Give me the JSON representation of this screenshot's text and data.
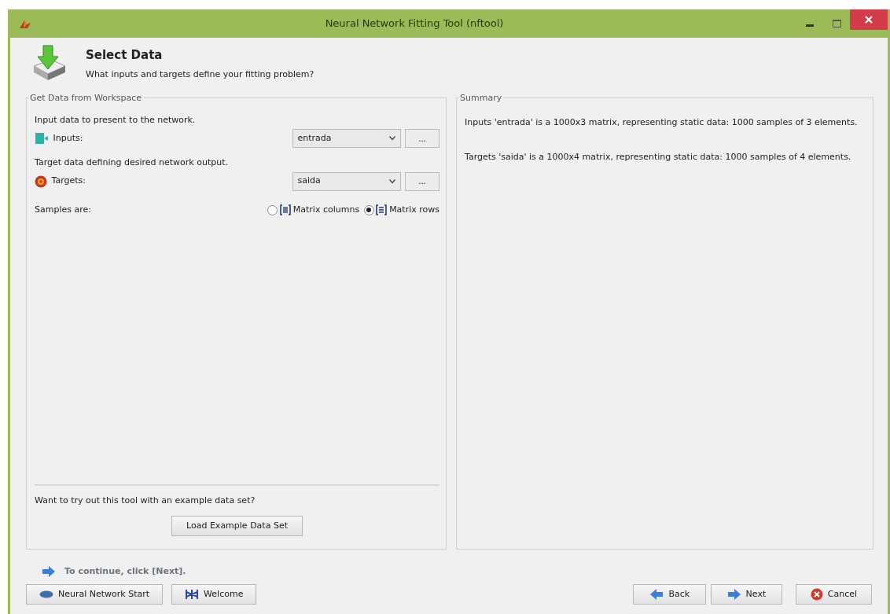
{
  "window": {
    "title": "Neural Network Fitting Tool (nftool)"
  },
  "header": {
    "title": "Select Data",
    "subtitle": "What inputs and targets define your fitting problem?"
  },
  "workspace_panel": {
    "title": "Get Data from Workspace",
    "fields": [
      {
        "hint": "Input data to present to the network.",
        "label": "Inputs:",
        "value": "entrada",
        "browse": "..."
      },
      {
        "hint": "Target data defining desired network output.",
        "label": "Targets:",
        "value": "saida",
        "browse": "..."
      }
    ],
    "samples": {
      "label": "Samples are:",
      "options": [
        {
          "label": "Matrix columns",
          "selected": false
        },
        {
          "label": "Matrix rows",
          "selected": true
        }
      ]
    },
    "example_prompt": "Want to try out this tool with an example data set?",
    "example_button": "Load Example Data Set"
  },
  "summary_panel": {
    "title": "Summary",
    "lines": [
      "Inputs 'entrada' is a 1000x3 matrix, representing static data: 1000 samples of 3 elements.",
      "Targets 'saida' is a 1000x4 matrix, representing static data: 1000 samples of 4 elements."
    ]
  },
  "instruction": "To continue, click [Next].",
  "left_buttons": [
    "Neural Network Start",
    "Welcome"
  ],
  "right_buttons": [
    "Back",
    "Next",
    "Cancel"
  ]
}
